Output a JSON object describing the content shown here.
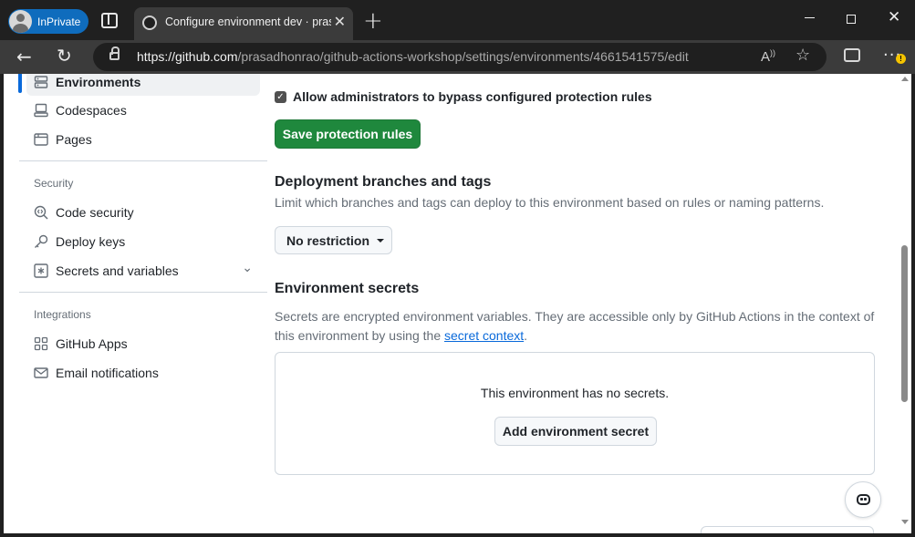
{
  "browser": {
    "inprivate_label": "InPrivate",
    "tab_title": "Configure environment dev · prasadhonrao/github-actions-workshop",
    "url_host": "https://github.com",
    "url_path": "/prasadhonrao/github-actions-workshop/settings/environments/4661541575/edit"
  },
  "sidebar": {
    "top_items": [
      {
        "label": "Environments",
        "icon": "server-icon",
        "active": true
      },
      {
        "label": "Codespaces",
        "icon": "codespaces-icon"
      },
      {
        "label": "Pages",
        "icon": "browser-icon"
      }
    ],
    "security": {
      "heading": "Security",
      "items": [
        {
          "label": "Code security",
          "icon": "codescan-icon"
        },
        {
          "label": "Deploy keys",
          "icon": "key-icon"
        },
        {
          "label": "Secrets and variables",
          "icon": "key-asterisk-icon"
        }
      ]
    },
    "integrations": {
      "heading": "Integrations",
      "items": [
        {
          "label": "GitHub Apps",
          "icon": "apps-icon"
        },
        {
          "label": "Email notifications",
          "icon": "mail-icon"
        }
      ]
    }
  },
  "main": {
    "bypass_checkbox_label": "Allow administrators to bypass configured protection rules",
    "bypass_checked": true,
    "save_button": "Save protection rules",
    "branches": {
      "title": "Deployment branches and tags",
      "description": "Limit which branches and tags can deploy to this environment based on rules or naming patterns.",
      "dropdown_value": "No restriction"
    },
    "secrets": {
      "title": "Environment secrets",
      "description_1": "Secrets are encrypted environment variables. They are accessible only by GitHub Actions in the context of",
      "description_2": "this environment by using the ",
      "link": "secret context",
      "description_end": ".",
      "empty_text": "This environment has no secrets.",
      "add_button": "Add environment secret"
    }
  },
  "colors": {
    "primary_button": "#1f883d",
    "link": "#0969da",
    "active_indicator": "#0969da",
    "inprivate_badge": "#0f6cbd"
  }
}
